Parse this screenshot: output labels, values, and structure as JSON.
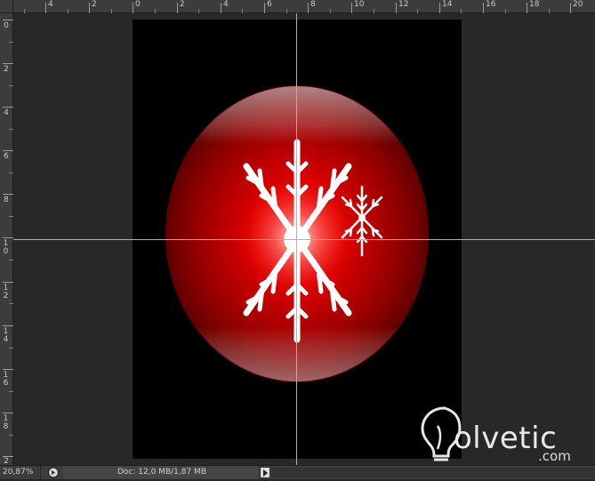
{
  "rulers": {
    "horizontal_labels": [
      "4",
      "2",
      "0",
      "2",
      "4",
      "6",
      "8",
      "10",
      "12",
      "14",
      "16",
      "18",
      "20"
    ],
    "vertical_labels": [
      "0",
      "2",
      "4",
      "6",
      "8",
      "10",
      "12",
      "14",
      "16",
      "18",
      "2"
    ]
  },
  "canvas": {
    "background": "#000000",
    "ornament_color": "#c80000",
    "snowflake_color": "#ffffff",
    "guide_color": "#3fe0e8"
  },
  "watermark": {
    "text": "olvetic",
    "suffix": ".com"
  },
  "status": {
    "zoom": "20,87%",
    "doc_info": "Doc: 12,0 MB/1,87 MB"
  },
  "icons": {
    "share": "share-icon",
    "menu_arrow": "triangle-right-icon"
  }
}
